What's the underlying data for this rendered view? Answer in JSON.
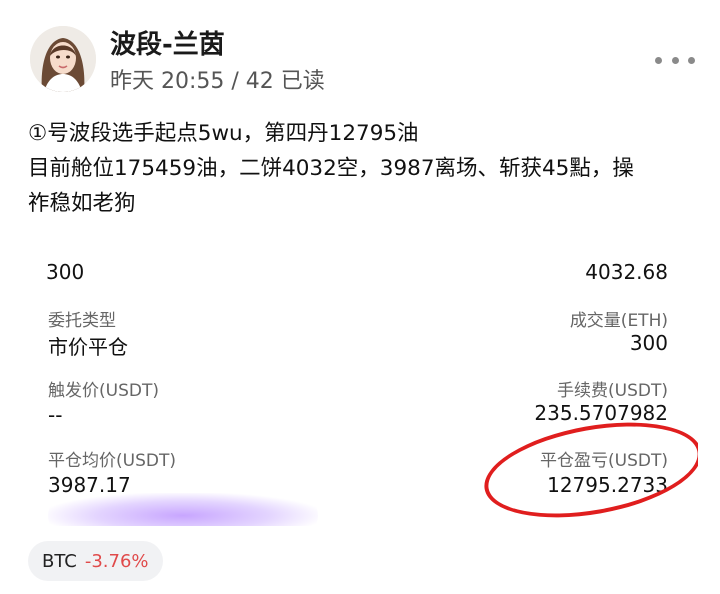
{
  "header": {
    "author": "波段-兰茵",
    "meta": "昨天 20:55 / 42 已读"
  },
  "post": {
    "lines": [
      "①号波段选手起点5wu，第四丹12795油",
      "目前舱位175459油，二饼4032空，3987离场、斩获45點，操",
      "祚稳如老狗"
    ]
  },
  "screenshot": {
    "left_value_top": "300",
    "right_value_top": "4032.68",
    "entrust_type_label": "委托类型",
    "entrust_type_value": "市价平仓",
    "filled_qty_label": "成交量(ETH)",
    "filled_qty_value": "300",
    "trigger_price_label": "触发价(USDT)",
    "trigger_price_value": "--",
    "fee_label": "手续费(USDT)",
    "fee_value": "235.5707982",
    "close_avg_label": "平仓均价(USDT)",
    "close_avg_value": "3987.17",
    "close_pnl_label": "平仓盈亏(USDT)",
    "close_pnl_value": "12795.2733"
  },
  "ticker": {
    "symbol": "BTC",
    "change": "-3.76%",
    "change_color": "#e04a4a"
  }
}
